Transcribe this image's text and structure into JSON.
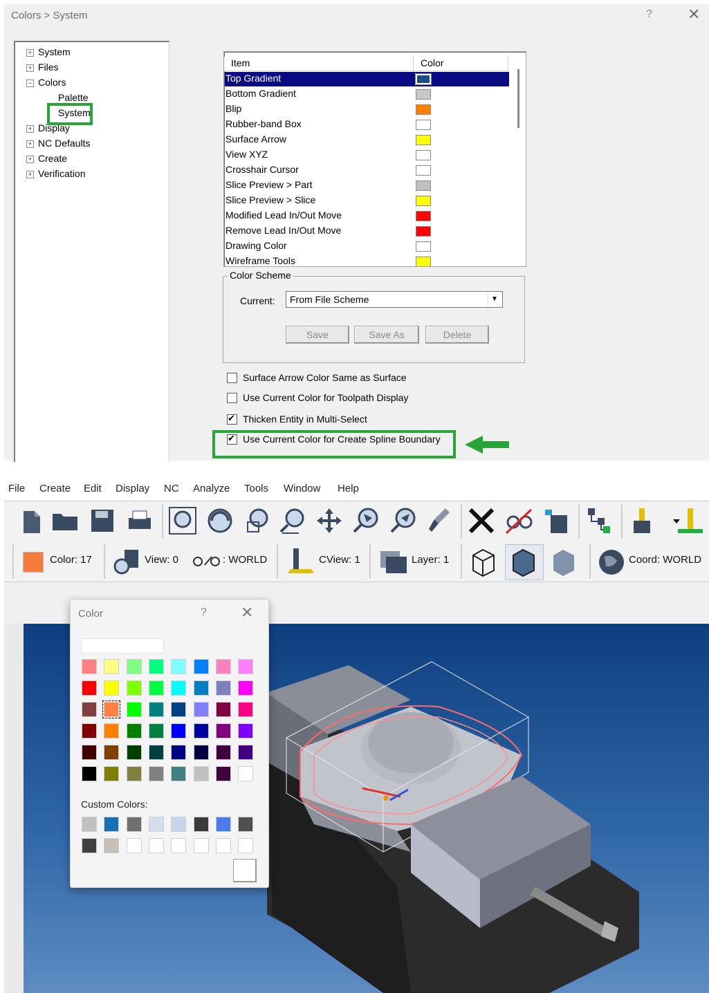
{
  "dialog": {
    "title": "Colors > System",
    "help": "?",
    "close": "✕"
  },
  "tree": {
    "items": [
      {
        "label": "System",
        "expander": "+"
      },
      {
        "label": "Files",
        "expander": "+"
      },
      {
        "label": "Colors",
        "expander": "−"
      },
      {
        "label": "Display",
        "expander": "+"
      },
      {
        "label": "NC Defaults",
        "expander": "+"
      },
      {
        "label": "Create",
        "expander": "+"
      },
      {
        "label": "Verification",
        "expander": "+"
      }
    ],
    "children": [
      "Palette",
      "System"
    ]
  },
  "list": {
    "col_item": "Item",
    "col_color": "Color",
    "rows": [
      {
        "label": "Top Gradient",
        "color": "#1a4f8a"
      },
      {
        "label": "Bottom Gradient",
        "color": "#c8c8c8"
      },
      {
        "label": "Blip",
        "color": "#ff8000"
      },
      {
        "label": "Rubber-band Box",
        "color": "#ffffff"
      },
      {
        "label": "Surface Arrow",
        "color": "#ffff00"
      },
      {
        "label": "View XYZ",
        "color": "#ffffff"
      },
      {
        "label": "Crosshair Cursor",
        "color": "#ffffff"
      },
      {
        "label": "Slice Preview > Part",
        "color": "#c0c0c0"
      },
      {
        "label": "Slice Preview > Slice",
        "color": "#ffff00"
      },
      {
        "label": "Modified Lead In/Out Move",
        "color": "#ff0000"
      },
      {
        "label": "Remove Lead In/Out Move",
        "color": "#ff0000"
      },
      {
        "label": "Drawing Color",
        "color": "#ffffff"
      },
      {
        "label": "Wireframe Tools",
        "color": "#ffff00"
      }
    ]
  },
  "scheme": {
    "legend": "Color Scheme",
    "current_label": "Current:",
    "current_value": "From File Scheme",
    "save": "Save",
    "save_as": "Save As",
    "delete": "Delete"
  },
  "options": [
    {
      "label": "Surface Arrow Color Same as Surface",
      "checked": false
    },
    {
      "label": "Use Current Color for Toolpath Display",
      "checked": false
    },
    {
      "label": "Thicken Entity in Multi-Select",
      "checked": true
    },
    {
      "label": "Use Current Color for Create Spline Boundary",
      "checked": true
    }
  ],
  "menubar": [
    "File",
    "Create",
    "Edit",
    "Display",
    "NC",
    "Analyze",
    "Tools",
    "Window",
    "Help"
  ],
  "status": {
    "color": "Color: 17",
    "view": "View: 0",
    "wp": ": WORLD",
    "cview": "CView: 1",
    "layer": "Layer: 1",
    "coord": "Coord: WORLD",
    "current_color": "#f47c3c"
  },
  "color_dialog": {
    "title": "Color",
    "help": "?",
    "close": "✕",
    "custom_label": "Custom Colors:",
    "basic": [
      [
        "#ff8080",
        "#ffff80",
        "#80ff80",
        "#00ff80",
        "#80ffff",
        "#0080ff",
        "#ff80c0",
        "#ff80ff"
      ],
      [
        "#ff0000",
        "#ffff00",
        "#80ff00",
        "#00ff40",
        "#00ffff",
        "#0080c0",
        "#8080c0",
        "#ff00ff"
      ],
      [
        "#804040",
        "#ff8040",
        "#00ff00",
        "#008080",
        "#004080",
        "#8080ff",
        "#800040",
        "#ff0080"
      ],
      [
        "#800000",
        "#ff8000",
        "#008000",
        "#008040",
        "#0000ff",
        "#0000a0",
        "#800080",
        "#8000ff"
      ],
      [
        "#400000",
        "#804000",
        "#004000",
        "#004040",
        "#000080",
        "#000040",
        "#400040",
        "#400080"
      ],
      [
        "#000000",
        "#808000",
        "#808040",
        "#808080",
        "#408080",
        "#c0c0c0",
        "#400040",
        "#ffffff"
      ]
    ],
    "custom": [
      [
        "#c0c0c0",
        "#1a6fb0",
        "#707070",
        "#d4dcf0",
        "#c8d4ec",
        "#3a3a3a",
        "#4a7cf0",
        "#505050"
      ],
      [
        "#404040",
        "#c4c0b8",
        "#ffffff",
        "#ffffff",
        "#ffffff",
        "#ffffff",
        "#ffffff",
        "#ffffff"
      ]
    ]
  }
}
